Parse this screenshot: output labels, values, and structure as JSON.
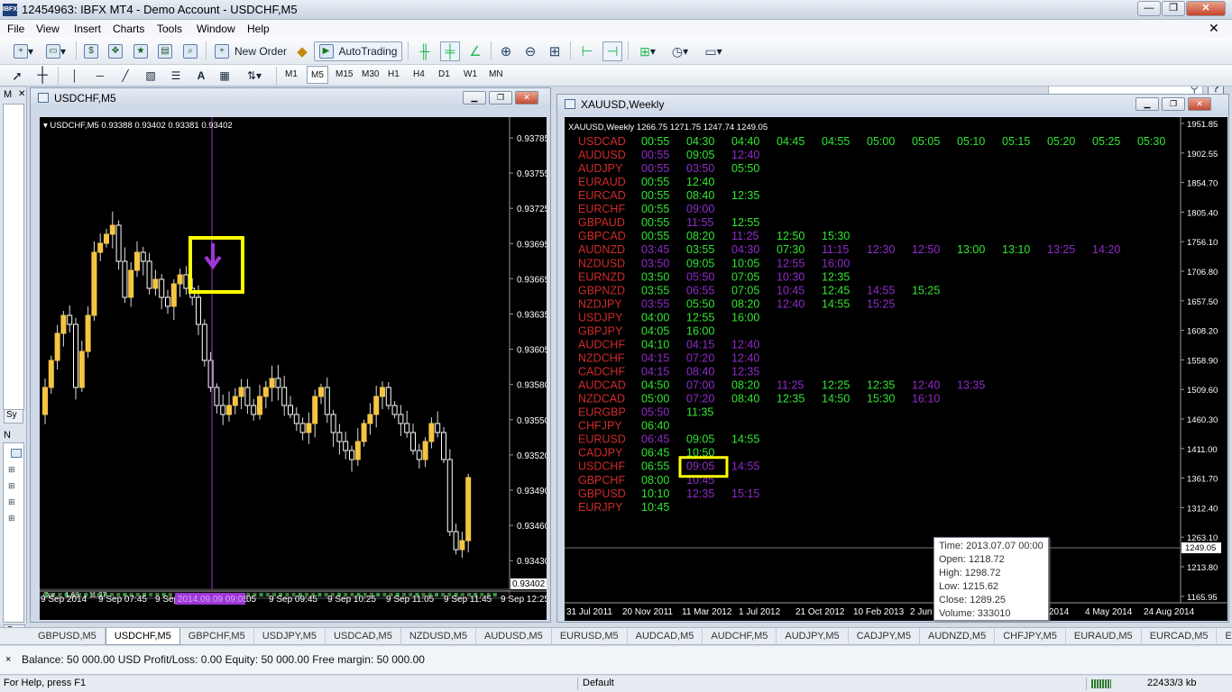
{
  "app": {
    "title": "12454963: IBFX MT4 - Demo Account - USDCHF,M5",
    "icon_text": "IBFX"
  },
  "window_controls": [
    "minimize-icon",
    "restore-icon",
    "close-icon"
  ],
  "menu": [
    "File",
    "View",
    "Insert",
    "Charts",
    "Tools",
    "Window",
    "Help"
  ],
  "toolbar": {
    "new_order": "New Order",
    "autotrading": "AutoTrading"
  },
  "timeframes": [
    "M1",
    "M5",
    "M15",
    "M30",
    "H1",
    "H4",
    "D1",
    "W1",
    "MN"
  ],
  "active_timeframe": "M5",
  "left_panel": {
    "market_watch_short": "M",
    "symbols_tab_short": "Sy",
    "navigator_short": "N",
    "common_tab_short": "Co"
  },
  "chart1": {
    "window_title": "USDCHF,M5",
    "info": "USDCHF,M5  0.93388 0.93402 0.93381 0.93402",
    "price_labels": [
      "0.93785",
      "0.93755",
      "0.93725",
      "0.93695",
      "0.93665",
      "0.93635",
      "0.93605",
      "0.93580",
      "0.93550",
      "0.93520",
      "0.93490",
      "0.93460",
      "0.93430"
    ],
    "current_price": "0.93402",
    "time_labels": [
      "9 Sep 2014",
      "9 Sep 07:45",
      "9 Sep",
      "05",
      "9 Sep 09:45",
      "9 Sep 10:25",
      "9 Sep 11:05",
      "9 Sep 11:45",
      "9 Sep 12:25"
    ],
    "cursor_time": "2014.09.09 09:05",
    "indicator_label": "Cor ... 1.68 ... 11.37",
    "signal_icon": "arrow-down-icon",
    "highlight_color": "#ffff00",
    "bull_color": "#f5c542",
    "bear_color": "#ffffff",
    "vline_color": "#9d37d6"
  },
  "chart2": {
    "window_title": "XAUUSD,Weekly",
    "info": "XAUUSD,Weekly  1266.75 1271.75 1247.74 1249.05",
    "price_labels": [
      "1951.85",
      "1902.55",
      "1854.70",
      "1805.40",
      "1756.10",
      "1706.80",
      "1657.50",
      "1608.20",
      "1558.90",
      "1509.60",
      "1460.30",
      "1411.00",
      "1361.70",
      "1312.40",
      "1263.10",
      "1213.80",
      "1165.95"
    ],
    "current_price": "1249.05",
    "time_labels": [
      "31 Jul 2011",
      "20 Nov 2011",
      "11 Mar 2012",
      "1 Jul 2012",
      "21 Oct 2012",
      "10 Feb 2013",
      "2 Jun",
      "2014",
      "4 May 2014",
      "24 Aug 2014"
    ],
    "green_color": "#32e632",
    "purple_color": "#8f2cc9",
    "symbol_color": "#d12a2a",
    "schedule": [
      {
        "symbol": "USDCAD",
        "times": [
          [
            "00:55",
            "g"
          ],
          [
            "04:30",
            "g"
          ],
          [
            "04:40",
            "g"
          ],
          [
            "04:45",
            "g"
          ],
          [
            "04:55",
            "g"
          ],
          [
            "05:00",
            "g"
          ],
          [
            "05:05",
            "g"
          ],
          [
            "05:10",
            "g"
          ],
          [
            "05:15",
            "g"
          ],
          [
            "05:20",
            "g"
          ],
          [
            "05:25",
            "g"
          ],
          [
            "05:30",
            "g"
          ]
        ]
      },
      {
        "symbol": "AUDUSD",
        "times": [
          [
            "00:55",
            "p"
          ],
          [
            "09:05",
            "g"
          ],
          [
            "12:40",
            "p"
          ]
        ]
      },
      {
        "symbol": "AUDJPY",
        "times": [
          [
            "00:55",
            "p"
          ],
          [
            "03:50",
            "p"
          ],
          [
            "05:50",
            "g"
          ]
        ]
      },
      {
        "symbol": "EURAUD",
        "times": [
          [
            "00:55",
            "g"
          ],
          [
            "12:40",
            "g"
          ]
        ]
      },
      {
        "symbol": "EURCAD",
        "times": [
          [
            "00:55",
            "g"
          ],
          [
            "08:40",
            "g"
          ],
          [
            "12:35",
            "g"
          ]
        ]
      },
      {
        "symbol": "EURCHF",
        "times": [
          [
            "00:55",
            "g"
          ],
          [
            "09:00",
            "p"
          ]
        ]
      },
      {
        "symbol": "GBPAUD",
        "times": [
          [
            "00:55",
            "g"
          ],
          [
            "11:55",
            "p"
          ],
          [
            "12:55",
            "g"
          ]
        ]
      },
      {
        "symbol": "GBPCAD",
        "times": [
          [
            "00:55",
            "g"
          ],
          [
            "08:20",
            "g"
          ],
          [
            "11:25",
            "p"
          ],
          [
            "12:50",
            "g"
          ],
          [
            "15:30",
            "g"
          ]
        ]
      },
      {
        "symbol": "AUDNZD",
        "times": [
          [
            "03:45",
            "p"
          ],
          [
            "03:55",
            "g"
          ],
          [
            "04:30",
            "p"
          ],
          [
            "07:30",
            "g"
          ],
          [
            "11:15",
            "p"
          ],
          [
            "12:30",
            "p"
          ],
          [
            "12:50",
            "p"
          ],
          [
            "13:00",
            "g"
          ],
          [
            "13:10",
            "g"
          ],
          [
            "13:25",
            "p"
          ],
          [
            "14:20",
            "p"
          ]
        ]
      },
      {
        "symbol": "NZDUSD",
        "times": [
          [
            "03:50",
            "p"
          ],
          [
            "09:05",
            "g"
          ],
          [
            "10:05",
            "g"
          ],
          [
            "12:55",
            "p"
          ],
          [
            "16:00",
            "p"
          ]
        ]
      },
      {
        "symbol": "EURNZD",
        "times": [
          [
            "03:50",
            "g"
          ],
          [
            "05:50",
            "p"
          ],
          [
            "07:05",
            "g"
          ],
          [
            "10:30",
            "p"
          ],
          [
            "12:35",
            "g"
          ]
        ]
      },
      {
        "symbol": "GBPNZD",
        "times": [
          [
            "03:55",
            "g"
          ],
          [
            "06:55",
            "p"
          ],
          [
            "07:05",
            "g"
          ],
          [
            "10:45",
            "p"
          ],
          [
            "12:45",
            "g"
          ],
          [
            "14:55",
            "p"
          ],
          [
            "15:25",
            "g"
          ]
        ]
      },
      {
        "symbol": "NZDJPY",
        "times": [
          [
            "03:55",
            "p"
          ],
          [
            "05:50",
            "g"
          ],
          [
            "08:20",
            "g"
          ],
          [
            "12:40",
            "p"
          ],
          [
            "14:55",
            "g"
          ],
          [
            "15:25",
            "p"
          ]
        ]
      },
      {
        "symbol": "USDJPY",
        "times": [
          [
            "04:00",
            "g"
          ],
          [
            "12:55",
            "g"
          ],
          [
            "16:00",
            "g"
          ]
        ]
      },
      {
        "symbol": "GBPJPY",
        "times": [
          [
            "04:05",
            "g"
          ],
          [
            "16:00",
            "g"
          ]
        ]
      },
      {
        "symbol": "AUDCHF",
        "times": [
          [
            "04:10",
            "g"
          ],
          [
            "04:15",
            "p"
          ],
          [
            "12:40",
            "p"
          ]
        ]
      },
      {
        "symbol": "NZDCHF",
        "times": [
          [
            "04:15",
            "p"
          ],
          [
            "07:20",
            "p"
          ],
          [
            "12:40",
            "p"
          ]
        ]
      },
      {
        "symbol": "CADCHF",
        "times": [
          [
            "04:15",
            "p"
          ],
          [
            "08:40",
            "p"
          ],
          [
            "12:35",
            "p"
          ]
        ]
      },
      {
        "symbol": "AUDCAD",
        "times": [
          [
            "04:50",
            "g"
          ],
          [
            "07:00",
            "p"
          ],
          [
            "08:20",
            "g"
          ],
          [
            "11:25",
            "p"
          ],
          [
            "12:25",
            "g"
          ],
          [
            "12:35",
            "g"
          ],
          [
            "12:40",
            "p"
          ],
          [
            "13:35",
            "p"
          ]
        ]
      },
      {
        "symbol": "NZDCAD",
        "times": [
          [
            "05:00",
            "g"
          ],
          [
            "07:20",
            "p"
          ],
          [
            "08:40",
            "g"
          ],
          [
            "12:35",
            "g"
          ],
          [
            "14:50",
            "g"
          ],
          [
            "15:30",
            "g"
          ],
          [
            "16:10",
            "p"
          ]
        ]
      },
      {
        "symbol": "EURGBP",
        "times": [
          [
            "05:50",
            "p"
          ],
          [
            "11:35",
            "g"
          ]
        ]
      },
      {
        "symbol": "CHFJPY",
        "times": [
          [
            "06:40",
            "g"
          ]
        ]
      },
      {
        "symbol": "EURUSD",
        "times": [
          [
            "06:45",
            "p"
          ],
          [
            "09:05",
            "g"
          ],
          [
            "14:55",
            "g"
          ]
        ]
      },
      {
        "symbol": "CADJPY",
        "times": [
          [
            "06:45",
            "g"
          ],
          [
            "10:50",
            "g"
          ]
        ]
      },
      {
        "symbol": "USDCHF",
        "times": [
          [
            "06:55",
            "g"
          ],
          [
            "09:05",
            "p"
          ],
          [
            "14:55",
            "p"
          ]
        ]
      },
      {
        "symbol": "GBPCHF",
        "times": [
          [
            "08:00",
            "g"
          ],
          [
            "10:45",
            "p"
          ]
        ]
      },
      {
        "symbol": "GBPUSD",
        "times": [
          [
            "10:10",
            "g"
          ],
          [
            "12:35",
            "p"
          ],
          [
            "15:15",
            "p"
          ]
        ]
      },
      {
        "symbol": "EURJPY",
        "times": [
          [
            "10:45",
            "g"
          ]
        ]
      }
    ],
    "tooltip": [
      "Time: 2013.07.07 00:00",
      "Open: 1218.72",
      "High: 1298.72",
      "Low:  1215.62",
      "Close: 1289.25",
      "Volume: 333010"
    ]
  },
  "tabs": [
    "GBPUSD,M5",
    "USDCHF,M5",
    "GBPCHF,M5",
    "USDJPY,M5",
    "USDCAD,M5",
    "NZDUSD,M5",
    "AUDUSD,M5",
    "EURUSD,M5",
    "AUDCAD,M5",
    "AUDCHF,M5",
    "AUDJPY,M5",
    "CADJPY,M5",
    "AUDNZD,M5",
    "CHFJPY,M5",
    "EURAUD,M5",
    "EURCAD,M5",
    "EL"
  ],
  "active_tab": "USDCHF,M5",
  "terminal": {
    "close": "×",
    "summary": "Balance: 50 000.00 USD  Profit/Loss: 0.00  Equity: 50 000.00  Free margin: 50 000.00"
  },
  "status": {
    "help": "For Help, press F1",
    "profile": "Default",
    "traffic": "22433/3 kb"
  }
}
